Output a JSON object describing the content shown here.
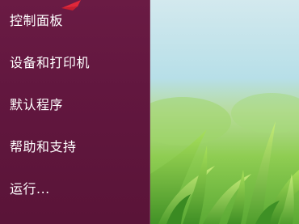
{
  "start_menu": {
    "items": [
      {
        "label": "控制面板"
      },
      {
        "label": "设备和打印机"
      },
      {
        "label": "默认程序"
      },
      {
        "label": "帮助和支持"
      },
      {
        "label": "运行..."
      }
    ]
  },
  "colors": {
    "panel": "#62173f",
    "annotation_arrow": "#e0283a"
  }
}
